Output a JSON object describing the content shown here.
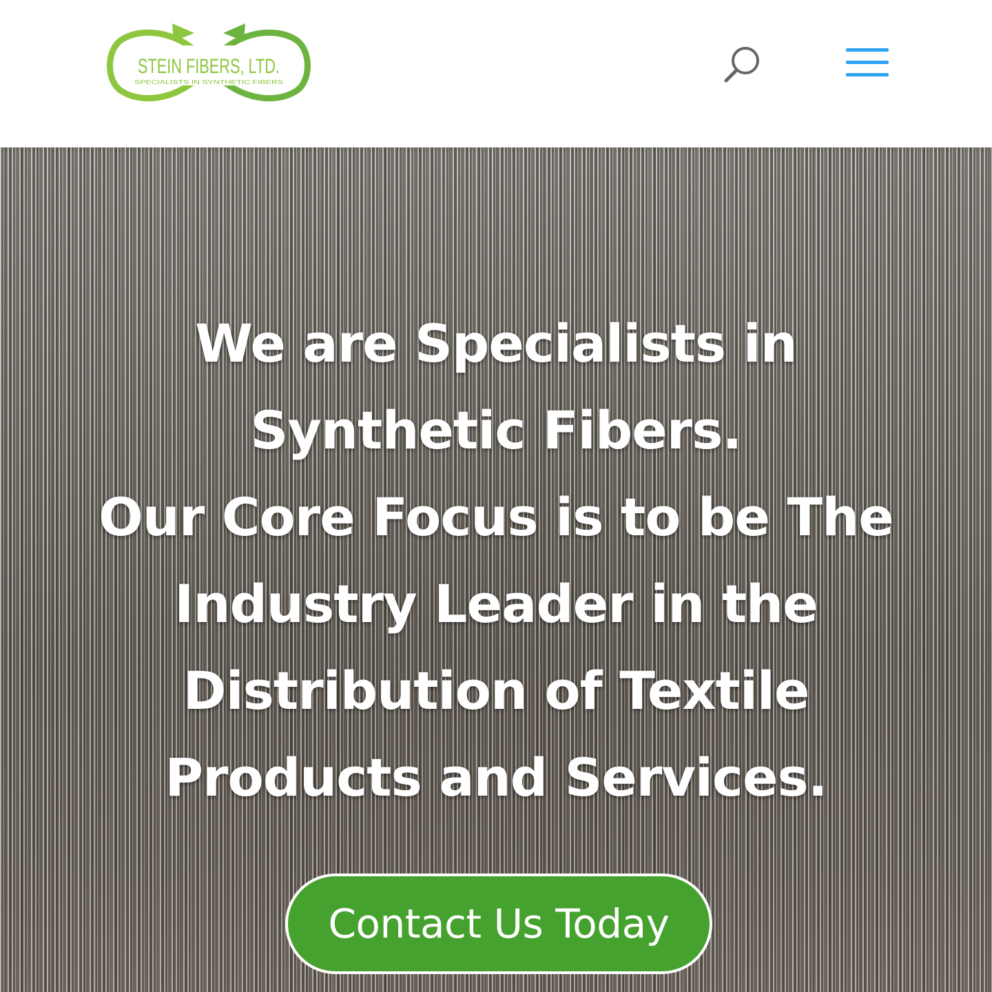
{
  "header": {
    "logo": {
      "name": "STEIN FIBERS, LTD.",
      "tagline": "SPECIALISTS IN SYNTHETIC FIBERS"
    },
    "search_icon": "search-icon",
    "menu_icon": "hamburger-menu-icon"
  },
  "hero": {
    "heading_line_1": "We are Specialists in Synthetic Fibers.",
    "heading_line_2": "Our Core Focus is to be The Industry Leader in the Distribution of Textile Products and Services.",
    "cta_label": "Contact Us Today"
  },
  "colors": {
    "logo_green": "#8dc63f",
    "logo_arrow_green": "#6db33f",
    "menu_blue": "#2ea3f2",
    "cta_green": "#46a22e",
    "search_gray": "#666666"
  }
}
